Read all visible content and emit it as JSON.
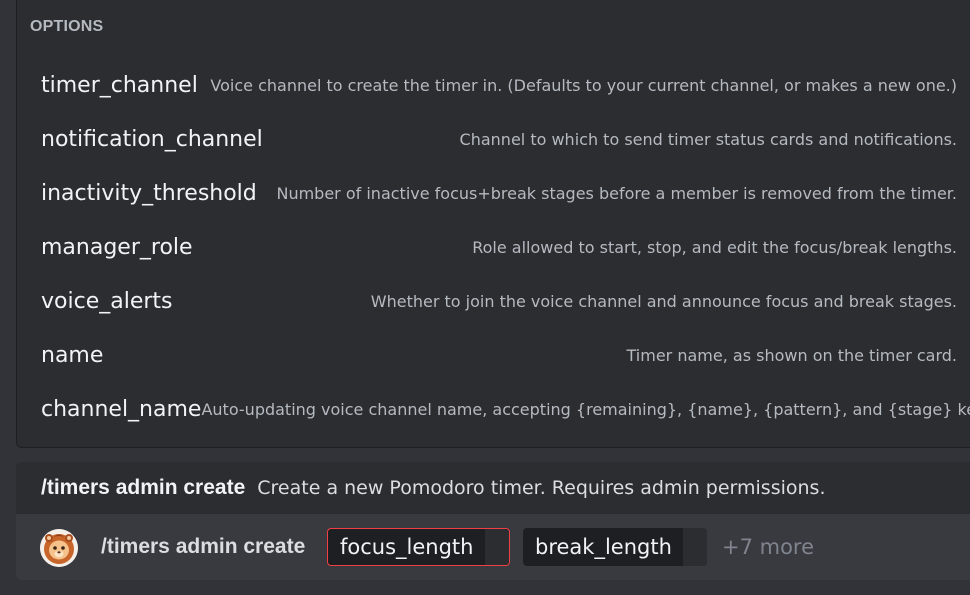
{
  "options": {
    "heading": "OPTIONS",
    "items": [
      {
        "name": "timer_channel",
        "description": "Voice channel to create the timer in. (Defaults to your current channel, or makes a new one.)"
      },
      {
        "name": "notification_channel",
        "description": "Channel to which to send timer status cards and notifications."
      },
      {
        "name": "inactivity_threshold",
        "description": "Number of inactive focus+break stages before a member is removed from the timer."
      },
      {
        "name": "manager_role",
        "description": "Role allowed to start, stop, and edit the focus/break lengths."
      },
      {
        "name": "voice_alerts",
        "description": "Whether to join the voice channel and announce focus and break stages."
      },
      {
        "name": "name",
        "description": "Timer name, as shown on the timer card."
      },
      {
        "name": "channel_name",
        "description": "Auto-updating voice channel name, accepting {remaining}, {name}, {pattern}, and {stage} keys."
      }
    ]
  },
  "command": {
    "name": "/timers admin create",
    "description": "Create a new Pomodoro timer. Requires admin permissions."
  },
  "input": {
    "avatar_icon": "lion-avatar-icon",
    "command_text": "/timers admin create",
    "params": [
      {
        "label": "focus_length",
        "active": true
      },
      {
        "label": "break_length",
        "active": false
      }
    ],
    "more": "+7 more"
  },
  "colors": {
    "background": "#313338",
    "panel": "#2b2d31",
    "input": "#383a40",
    "active_border": "#f23f43",
    "text_primary": "#f2f3f5",
    "text_muted": "#b5bac1"
  }
}
